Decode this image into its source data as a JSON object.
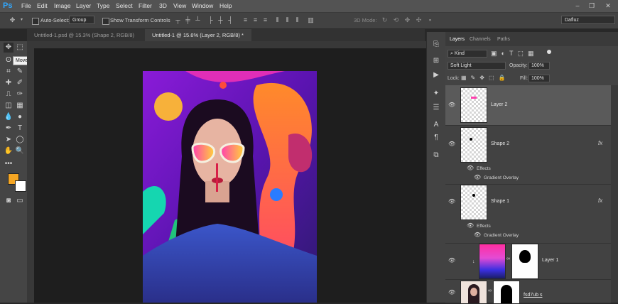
{
  "app": {
    "logo": "Ps"
  },
  "menu": [
    "File",
    "Edit",
    "Image",
    "Layer",
    "Type",
    "Select",
    "Filter",
    "3D",
    "View",
    "Window",
    "Help"
  ],
  "window_controls": {
    "minimize": "–",
    "restore": "❐",
    "close": "✕"
  },
  "options": {
    "auto_select_label": "Auto-Select:",
    "auto_select_value": "Group",
    "transform_label": "Show Transform Controls",
    "mode_3d_label": "3D Mode:",
    "workspace": "Dafluz"
  },
  "tabs": [
    {
      "label": "Untitled-1.psd @ 15.3% (Shape 2, RGB/8)",
      "close": "×"
    },
    {
      "label": "Untitled-1 @ 15.6% (Layer 2, RGB/8) *",
      "close": "×"
    }
  ],
  "tooltip": "Move Tool (V)",
  "colors": {
    "foreground": "#f5a623",
    "background": "#ffffff",
    "accent": "#31a8ff"
  },
  "panel": {
    "tabs": [
      "Layers",
      "Channels",
      "Paths"
    ],
    "filter_kind": "Kind",
    "blend_mode": "Soft Light",
    "opacity_label": "Opacity:",
    "opacity_value": "100%",
    "lock_label": "Lock:",
    "fill_label": "Fill:",
    "fill_value": "100%"
  },
  "layers": [
    {
      "name": "Layer 2",
      "selected": true
    },
    {
      "name": "Shape 2",
      "fx": "fx",
      "effects": "Effects",
      "effect": "Gradient Overlay"
    },
    {
      "name": "Shape 1",
      "fx": "fx",
      "effects": "Effects",
      "effect": "Gradient Overlay"
    },
    {
      "name": "Layer 1"
    },
    {
      "name": "fsd7ub s"
    }
  ]
}
